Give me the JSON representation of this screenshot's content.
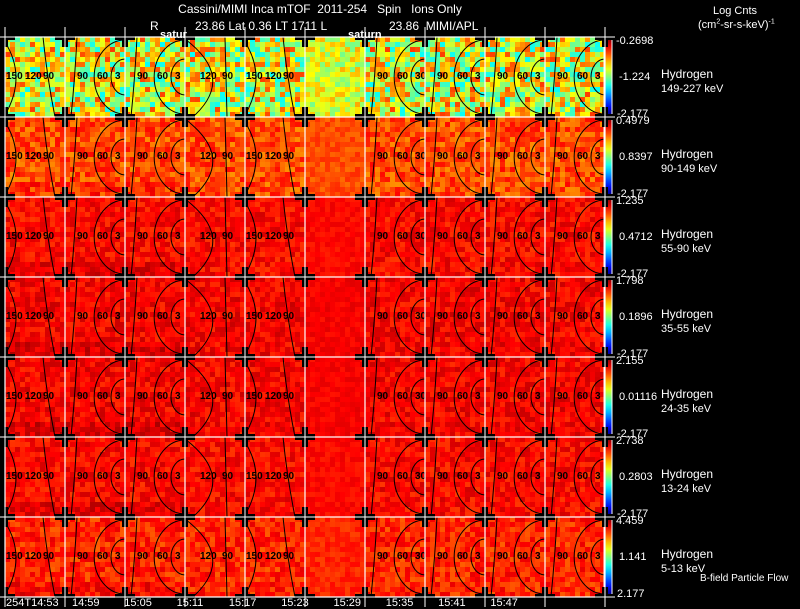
{
  "header": {
    "title": "Cassini/MIMI Inca mTOF  2011-254   Spin   Ions Only",
    "r_label": "R",
    "position": "23.86 Lat 0.36 LT 1711 L",
    "l_value_source": "23.86  MIMI/APL"
  },
  "units": {
    "line1": "Log Cnts",
    "line2_pre": "(cm",
    "line2_sup": "2",
    "line2_post": "-sr-s-keV)",
    "line2_exp": "-1"
  },
  "footer_note": "B-field Particle Flow",
  "overlay_labels": [
    "satur",
    "saturn"
  ],
  "colors": {
    "background": "#000000",
    "grid": "#ffffff",
    "contour": "#000000",
    "colormap": "jet"
  },
  "chart_data": {
    "type": "heatmap",
    "title": "Cassini/MIMI Inca mTOF  2011-254   Spin   Ions Only",
    "x_ticks": [
      "254T14:53",
      "14:59",
      "15:05",
      "15:11",
      "15:17",
      "15:23",
      "15:29",
      "15:35",
      "15:41",
      "15:47"
    ],
    "contour_labels": [
      [
        "150",
        "120",
        "90"
      ],
      [
        "90",
        "60",
        "3"
      ],
      [
        "90",
        "60",
        "3"
      ],
      [
        "120",
        "90"
      ],
      [
        "150",
        "120",
        "90"
      ],
      [],
      [
        "90",
        "60",
        "30"
      ],
      [
        "90",
        "60",
        "3"
      ],
      [
        "90",
        "60",
        "3"
      ],
      [
        "90",
        "60",
        "3"
      ]
    ],
    "panels": [
      {
        "species": "Hydrogen",
        "energy": "149-227 keV",
        "cbar_max": "-0.2698",
        "cbar_mid": "-1.224",
        "cbar_min": "-2.177",
        "level": 0.6,
        "spread": 0.22
      },
      {
        "species": "Hydrogen",
        "energy": "90-149 keV",
        "cbar_max": "0.4979",
        "cbar_mid": "0.8397",
        "cbar_min": "-2.177",
        "level": 0.8,
        "spread": 0.07
      },
      {
        "species": "Hydrogen",
        "energy": "55-90 keV",
        "cbar_max": "1.235",
        "cbar_mid": "0.4712",
        "cbar_min": "-2.177",
        "level": 0.87,
        "spread": 0.05
      },
      {
        "species": "Hydrogen",
        "energy": "35-55 keV",
        "cbar_max": "1.798",
        "cbar_mid": "0.1896",
        "cbar_min": "-2.177",
        "level": 0.88,
        "spread": 0.05
      },
      {
        "species": "Hydrogen",
        "energy": "24-35 keV",
        "cbar_max": "2.155",
        "cbar_mid": "0.01116",
        "cbar_min": "-2.177",
        "level": 0.88,
        "spread": 0.05
      },
      {
        "species": "Hydrogen",
        "energy": "13-24 keV",
        "cbar_max": "2.738",
        "cbar_mid": "0.2803",
        "cbar_min": "-2.177",
        "level": 0.87,
        "spread": 0.05
      },
      {
        "species": "Hydrogen",
        "energy": "5-13 keV",
        "cbar_max": "4.459",
        "cbar_mid": "1.141",
        "cbar_min": "2.177",
        "level": 0.84,
        "spread": 0.06
      }
    ]
  }
}
